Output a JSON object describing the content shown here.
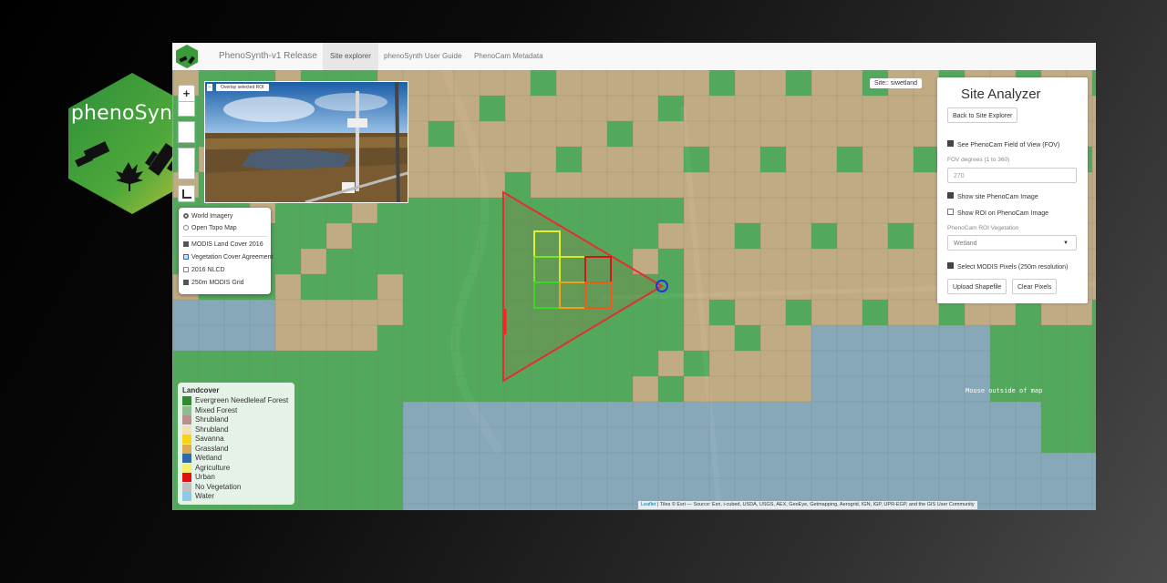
{
  "logo": {
    "text": "phenoSynth",
    "icon": "phenosynth-hexagon-logo"
  },
  "navbar": {
    "brand": "PhenoSynth-v1 Release",
    "tabs": [
      {
        "label": "Site explorer",
        "active": true
      },
      {
        "label": "phenoSynth User Guide",
        "active": false
      },
      {
        "label": "PhenoCam Metadata",
        "active": false
      }
    ]
  },
  "map": {
    "zoom_in_label": "+",
    "site_label": "Site:: siwetland",
    "overlay_button": "Overlay selected ROI",
    "mouse_status": "Mouse outside of map",
    "attribution_link": "Leaflet",
    "attribution_text": " | Tiles © Esri — Source: Esri, i-cubed, USDA, USGS, AEX, GeoEye, Getmapping, Aerogrid, IGN, IGP, UPR-EGP, and the GIS User Community"
  },
  "layers": {
    "base": [
      {
        "label": "World Imagery",
        "selected": true
      },
      {
        "label": "Open Topo Map",
        "selected": false
      }
    ],
    "overlays": [
      {
        "label": "MODIS Land Cover 2016",
        "checked": true
      },
      {
        "label": "Vegetation Cover Agreement",
        "checked": true
      },
      {
        "label": "2016 NLCD",
        "checked": false
      },
      {
        "label": "250m MODIS Grid",
        "checked": true
      }
    ]
  },
  "legend": {
    "title": "Landcover",
    "items": [
      {
        "label": "Evergreen Needleleaf Forest",
        "color": "#2e8b2e"
      },
      {
        "label": "Mixed Forest",
        "color": "#8fbc8f"
      },
      {
        "label": "Shrubland",
        "color": "#bc8f8f"
      },
      {
        "label": "Shrubland",
        "color": "#f5deb3"
      },
      {
        "label": "Savanna",
        "color": "#f5d515"
      },
      {
        "label": "Grassland",
        "color": "#e0a850"
      },
      {
        "label": "Wetland",
        "color": "#2c6aa8"
      },
      {
        "label": "Agriculture",
        "color": "#f3f36a"
      },
      {
        "label": "Urban",
        "color": "#e01010"
      },
      {
        "label": "No Vegetation",
        "color": "#c0c0c0"
      },
      {
        "label": "Water",
        "color": "#8ec9ea"
      }
    ]
  },
  "analyzer": {
    "title": "Site Analyzer",
    "back_button": "Back to Site Explorer",
    "fov_check": "See PhenoCam Field of View (FOV)",
    "fov_label": "FOV degrees (1 to 360)",
    "fov_value": "270",
    "show_image_check": "Show site PhenoCam Image",
    "show_roi_check": "Show ROI on PhenoCam Image",
    "roi_veg_label": "PhenoCam ROI Vegetation",
    "roi_veg_value": "Wetland",
    "select_pixels_check": "Select MODIS Pixels (250m resolution)",
    "upload_button": "Upload Shapefile",
    "clear_button": "Clear Pixels"
  },
  "colors": {
    "grid_green": "#3aa84a",
    "grid_tan": "#c8aa7c",
    "grid_blue": "#7ea6c2",
    "fov_triangle": "#e03030",
    "site_marker": "#2233dd"
  }
}
